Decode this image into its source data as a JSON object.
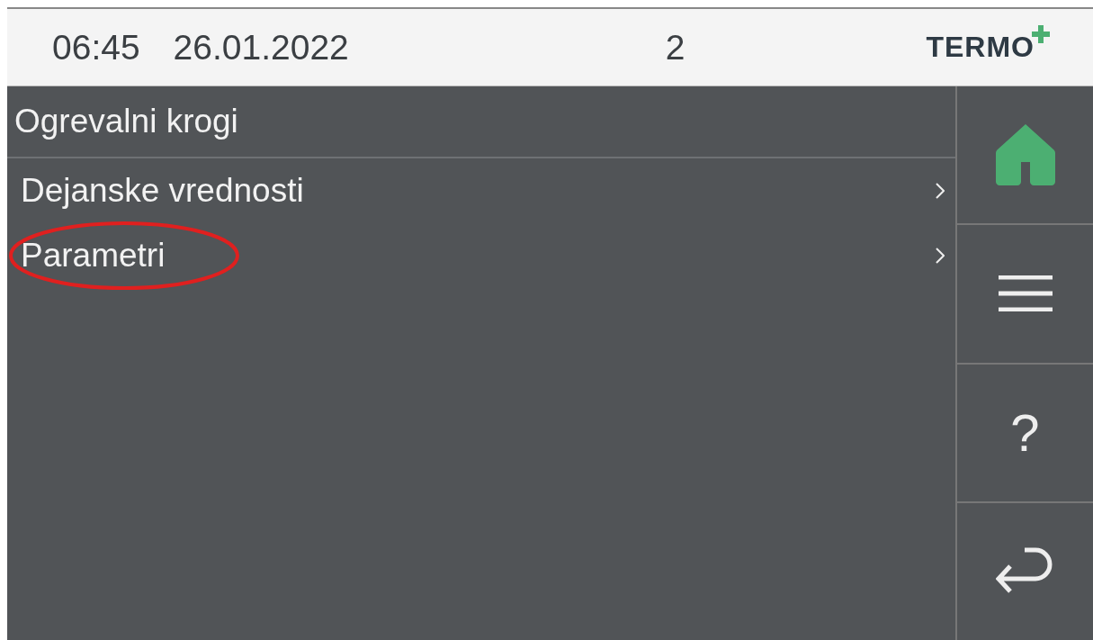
{
  "status_bar": {
    "time": "06:45",
    "date": "26.01.2022",
    "count": "2",
    "logo": "TERMO"
  },
  "title": "Ogrevalni krogi",
  "menu_items": [
    {
      "label": "Dejanske vrednosti",
      "circled": false
    },
    {
      "label": "Parametri",
      "circled": true
    }
  ],
  "side_buttons": [
    {
      "kind": "home",
      "selected": true
    },
    {
      "kind": "menu",
      "selected": false
    },
    {
      "kind": "help",
      "label": "?",
      "selected": false
    },
    {
      "kind": "back",
      "selected": false
    }
  ]
}
